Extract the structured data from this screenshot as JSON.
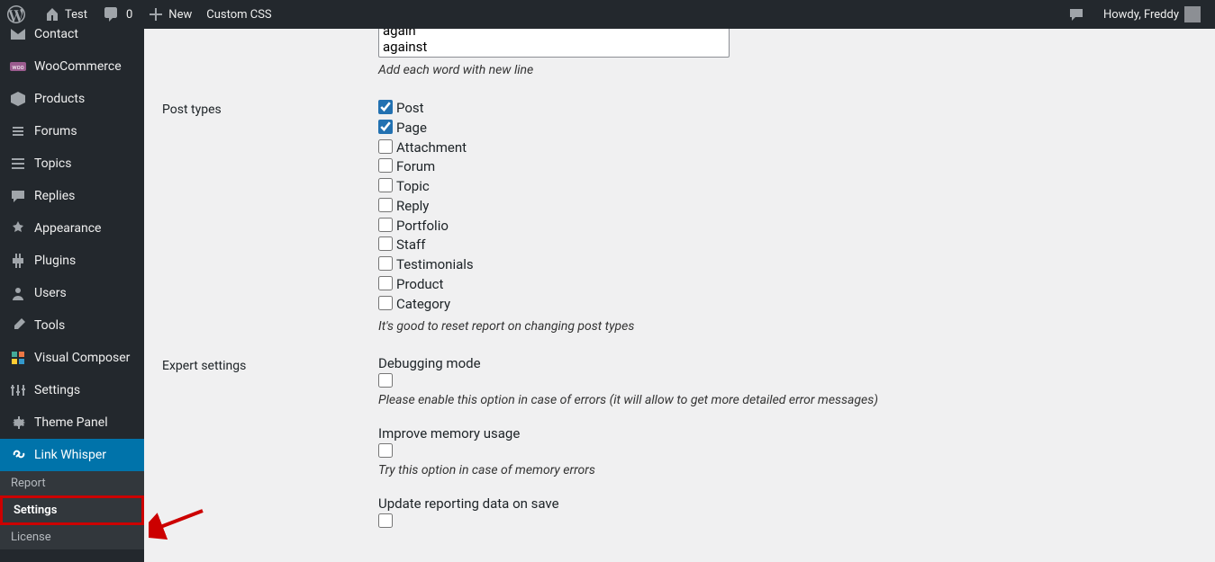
{
  "adminbar": {
    "site_name": "Test",
    "comments_count": "0",
    "new_label": "New",
    "custom_css": "Custom CSS",
    "howdy": "Howdy, Freddy"
  },
  "sidebar": {
    "partial_top": "Contact",
    "items": [
      {
        "label": "WooCommerce"
      },
      {
        "label": "Products"
      },
      {
        "label": "Forums"
      },
      {
        "label": "Topics"
      },
      {
        "label": "Replies"
      },
      {
        "label": "Appearance"
      },
      {
        "label": "Plugins"
      },
      {
        "label": "Users"
      },
      {
        "label": "Tools"
      },
      {
        "label": "Visual Composer"
      },
      {
        "label": "Settings"
      },
      {
        "label": "Theme Panel"
      },
      {
        "label": "Link Whisper"
      }
    ],
    "sub": [
      {
        "label": "Report"
      },
      {
        "label": "Settings"
      },
      {
        "label": "License"
      }
    ]
  },
  "form": {
    "words_options": [
      "again",
      "against"
    ],
    "words_help": "Add each word with new line",
    "post_types_label": "Post types",
    "post_types": [
      {
        "label": "Post",
        "checked": true
      },
      {
        "label": "Page",
        "checked": true
      },
      {
        "label": "Attachment",
        "checked": false
      },
      {
        "label": "Forum",
        "checked": false
      },
      {
        "label": "Topic",
        "checked": false
      },
      {
        "label": "Reply",
        "checked": false
      },
      {
        "label": "Portfolio",
        "checked": false
      },
      {
        "label": "Staff",
        "checked": false
      },
      {
        "label": "Testimonials",
        "checked": false
      },
      {
        "label": "Product",
        "checked": false
      },
      {
        "label": "Category",
        "checked": false
      }
    ],
    "post_types_help": "It's good to reset report on changing post types",
    "expert_label": "Expert settings",
    "expert": [
      {
        "title": "Debugging mode",
        "help": "Please enable this option in case of errors (it will allow to get more detailed error messages)"
      },
      {
        "title": "Improve memory usage",
        "help": "Try this option in case of memory errors"
      },
      {
        "title": "Update reporting data on save",
        "help": ""
      }
    ]
  }
}
